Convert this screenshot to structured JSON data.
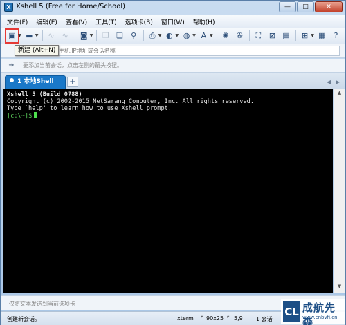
{
  "window": {
    "title": "Xshell 5 (Free for Home/School)"
  },
  "window_buttons": [
    "—",
    "□",
    "✕"
  ],
  "menu": [
    "文件(F)",
    "编辑(E)",
    "查看(V)",
    "工具(T)",
    "选项卡(B)",
    "窗口(W)",
    "帮助(H)"
  ],
  "tooltip": "新建 (Alt+N)",
  "address_bar": {
    "placeholder": "主机,IP地址或会话名称"
  },
  "hint_bar": {
    "text": "要添加当前会话，点击左侧的箭头按钮。"
  },
  "tabs": {
    "active_label": "1 本地Shell",
    "add_label": "+"
  },
  "terminal": {
    "line1": "Xshell 5 (Build 0788)",
    "line2": "Copyright (c) 2002-2015 NetSarang Computer, Inc. All rights reserved.",
    "line3": "",
    "line4": "Type `help' to learn how to use Xshell prompt.",
    "prompt": "[c:\\~]$"
  },
  "compose_bar": {
    "text": "仅将文本发送到当前选项卡"
  },
  "status": {
    "left": "创建新会话。",
    "term": "xterm",
    "size": "90x25",
    "pos": "5,9",
    "sessions": "1 会话"
  },
  "watermark": {
    "text": "成航先森",
    "url": "www.cnbvfj.cn"
  },
  "colors": {
    "tab_active": "#1a78c8",
    "prompt": "#5fd35f",
    "highlight": "#e53935"
  }
}
